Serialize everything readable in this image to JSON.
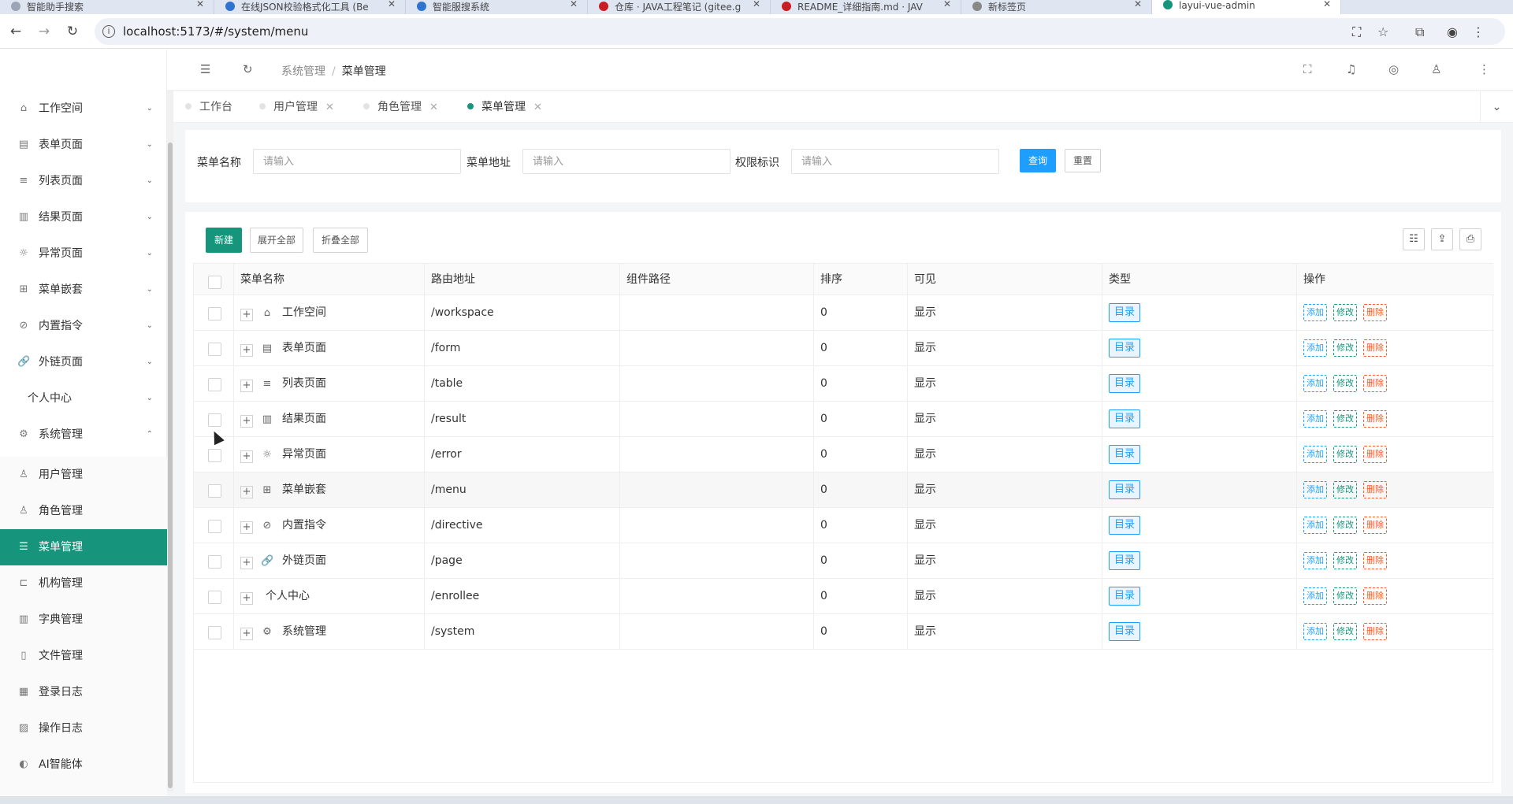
{
  "browser": {
    "tabs": [
      {
        "title": "智能助手搜索",
        "color": "#9aa5b8"
      },
      {
        "title": "在线JSON校验格式化工具 (Be",
        "color": "#2f74d0"
      },
      {
        "title": "智能服搜系统",
        "color": "#2f74d0"
      },
      {
        "title": "仓库 · JAVA工程笔记 (gitee.g",
        "color": "#c71d23"
      },
      {
        "title": "README_详细指南.md · JAV",
        "color": "#c71d23"
      },
      {
        "title": "新标签页",
        "color": "#888888"
      },
      {
        "title": "layui-vue-admin",
        "color": "#16947c"
      }
    ],
    "url": "localhost:5173/#/system/menu"
  },
  "sidebar": {
    "items": [
      {
        "label": "工作空间",
        "icon": "home-icon",
        "glyph": "⌂",
        "arrow": "⌄"
      },
      {
        "label": "表单页面",
        "icon": "table-icon",
        "glyph": "▤",
        "arrow": "⌄"
      },
      {
        "label": "列表页面",
        "icon": "list-icon",
        "glyph": "≡",
        "arrow": "⌄"
      },
      {
        "label": "结果页面",
        "icon": "result-icon",
        "glyph": "▥",
        "arrow": "⌄"
      },
      {
        "label": "异常页面",
        "icon": "bug-icon",
        "glyph": "☼",
        "arrow": "⌄"
      },
      {
        "label": "菜单嵌套",
        "icon": "app-icon",
        "glyph": "⊞",
        "arrow": "⌄"
      },
      {
        "label": "内置指令",
        "icon": "directive-icon",
        "glyph": "⊘",
        "arrow": "⌄"
      },
      {
        "label": "外链页面",
        "icon": "link-icon",
        "glyph": "🔗",
        "arrow": "⌄"
      },
      {
        "label": "个人中心",
        "icon": "",
        "glyph": "",
        "arrow": "⌄"
      },
      {
        "label": "系统管理",
        "icon": "gear-icon",
        "glyph": "⚙",
        "arrow": "⌃"
      }
    ],
    "subitems": [
      {
        "label": "用户管理",
        "icon": "user-icon",
        "glyph": "♙"
      },
      {
        "label": "角色管理",
        "icon": "role-icon",
        "glyph": "♙"
      },
      {
        "label": "菜单管理",
        "icon": "menu-icon",
        "glyph": "☰",
        "active": true
      },
      {
        "label": "机构管理",
        "icon": "org-icon",
        "glyph": "⊏"
      },
      {
        "label": "字典管理",
        "icon": "book-icon",
        "glyph": "▥"
      },
      {
        "label": "文件管理",
        "icon": "file-icon",
        "glyph": "▯"
      },
      {
        "label": "登录日志",
        "icon": "log-icon",
        "glyph": "▦"
      },
      {
        "label": "操作日志",
        "icon": "oplog-icon",
        "glyph": "▨"
      },
      {
        "label": "AI智能体",
        "icon": "ai-icon",
        "glyph": "◐"
      }
    ]
  },
  "header": {
    "breadcrumb_parent": "系统管理",
    "breadcrumb_sep": "/",
    "breadcrumb_current": "菜单管理"
  },
  "page_tabs": [
    {
      "label": "工作台",
      "closable": false
    },
    {
      "label": "用户管理",
      "closable": true
    },
    {
      "label": "角色管理",
      "closable": true
    },
    {
      "label": "菜单管理",
      "closable": true,
      "active": true
    }
  ],
  "search": {
    "name_label": "菜单名称",
    "path_label": "菜单地址",
    "perm_label": "权限标识",
    "placeholder": "请输入",
    "query_label": "查询",
    "reset_label": "重置"
  },
  "toolbar": {
    "new_label": "新建",
    "expand_label": "展开全部",
    "collapse_label": "折叠全部"
  },
  "table": {
    "columns": [
      "菜单名称",
      "路由地址",
      "组件路径",
      "排序",
      "可见",
      "类型",
      "操作"
    ],
    "rows": [
      {
        "name": "工作空间",
        "icon": "home-icon",
        "glyph": "⌂",
        "path": "/workspace",
        "component": "",
        "sort": "0",
        "visible": "显示",
        "type": "目录"
      },
      {
        "name": "表单页面",
        "icon": "table-icon",
        "glyph": "▤",
        "path": "/form",
        "component": "",
        "sort": "0",
        "visible": "显示",
        "type": "目录"
      },
      {
        "name": "列表页面",
        "icon": "list-icon",
        "glyph": "≡",
        "path": "/table",
        "component": "",
        "sort": "0",
        "visible": "显示",
        "type": "目录"
      },
      {
        "name": "结果页面",
        "icon": "result-icon",
        "glyph": "▥",
        "path": "/result",
        "component": "",
        "sort": "0",
        "visible": "显示",
        "type": "目录"
      },
      {
        "name": "异常页面",
        "icon": "bug-icon",
        "glyph": "☼",
        "path": "/error",
        "component": "",
        "sort": "0",
        "visible": "显示",
        "type": "目录"
      },
      {
        "name": "菜单嵌套",
        "icon": "app-icon",
        "glyph": "⊞",
        "path": "/menu",
        "component": "",
        "sort": "0",
        "visible": "显示",
        "type": "目录"
      },
      {
        "name": "内置指令",
        "icon": "directive-icon",
        "glyph": "⊘",
        "path": "/directive",
        "component": "",
        "sort": "0",
        "visible": "显示",
        "type": "目录"
      },
      {
        "name": "外链页面",
        "icon": "link-icon",
        "glyph": "🔗",
        "path": "/page",
        "component": "",
        "sort": "0",
        "visible": "显示",
        "type": "目录"
      },
      {
        "name": "个人中心",
        "icon": "",
        "glyph": "",
        "path": "/enrollee",
        "component": "",
        "sort": "0",
        "visible": "显示",
        "type": "目录"
      },
      {
        "name": "系统管理",
        "icon": "gear-icon",
        "glyph": "⚙",
        "path": "/system",
        "component": "",
        "sort": "0",
        "visible": "显示",
        "type": "目录"
      }
    ],
    "actions": {
      "add": "添加",
      "edit": "修改",
      "delete": "删除"
    }
  },
  "colors": {
    "primary": "#16947c",
    "info": "#1e9fff",
    "danger": "#ff5722"
  }
}
